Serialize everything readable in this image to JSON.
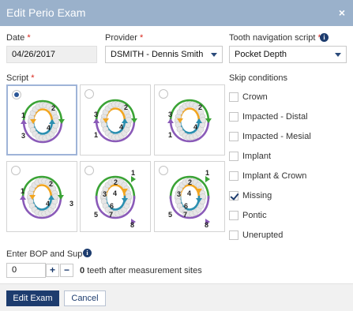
{
  "dialog": {
    "title": "Edit Perio Exam",
    "close": "×"
  },
  "date": {
    "label": "Date",
    "required": "*",
    "value": "04/26/2017"
  },
  "provider": {
    "label": "Provider",
    "required": "*",
    "value": "DSMITH - Dennis Smith"
  },
  "nav_script": {
    "label": "Tooth navigation script",
    "required": "*",
    "value": "Pocket Depth",
    "info": "i"
  },
  "script": {
    "label": "Script",
    "required": "*",
    "selected_index": 0,
    "cards": [
      {
        "labels": [
          "1",
          "2",
          "3",
          "4"
        ]
      },
      {
        "labels": [
          "3",
          "2",
          "1",
          "4"
        ]
      },
      {
        "labels": [
          "3",
          "2",
          "1",
          "4"
        ]
      },
      {
        "labels": [
          "1",
          "2",
          "4",
          "3"
        ]
      },
      {
        "labels": [
          "1",
          "2",
          "3",
          "4",
          "5",
          "6",
          "7",
          "8"
        ]
      },
      {
        "labels": [
          "1",
          "2",
          "3",
          "4",
          "5",
          "6",
          "7",
          "8"
        ]
      }
    ]
  },
  "skip": {
    "label": "Skip conditions",
    "items": [
      {
        "label": "Crown",
        "checked": false
      },
      {
        "label": "Impacted - Distal",
        "checked": false
      },
      {
        "label": "Impacted - Mesial",
        "checked": false
      },
      {
        "label": "Implant",
        "checked": false
      },
      {
        "label": "Implant & Crown",
        "checked": false
      },
      {
        "label": "Missing",
        "checked": true
      },
      {
        "label": "Pontic",
        "checked": false
      },
      {
        "label": "Unerupted",
        "checked": false
      }
    ]
  },
  "bop": {
    "label": "Enter BOP and Sup",
    "required": "*",
    "value": "0",
    "plus": "+",
    "minus": "−",
    "count": "0",
    "suffix": "teeth after measurement sites"
  },
  "footer": {
    "save": "Edit Exam",
    "cancel": "Cancel"
  },
  "colors": {
    "green": "#3aa335",
    "orange": "#f2a51f",
    "teal": "#2b8fb0",
    "purple": "#8a5ab8",
    "tooth": "#e6e6e6",
    "header": "#9ab1cb",
    "primary": "#1d3c6e"
  }
}
